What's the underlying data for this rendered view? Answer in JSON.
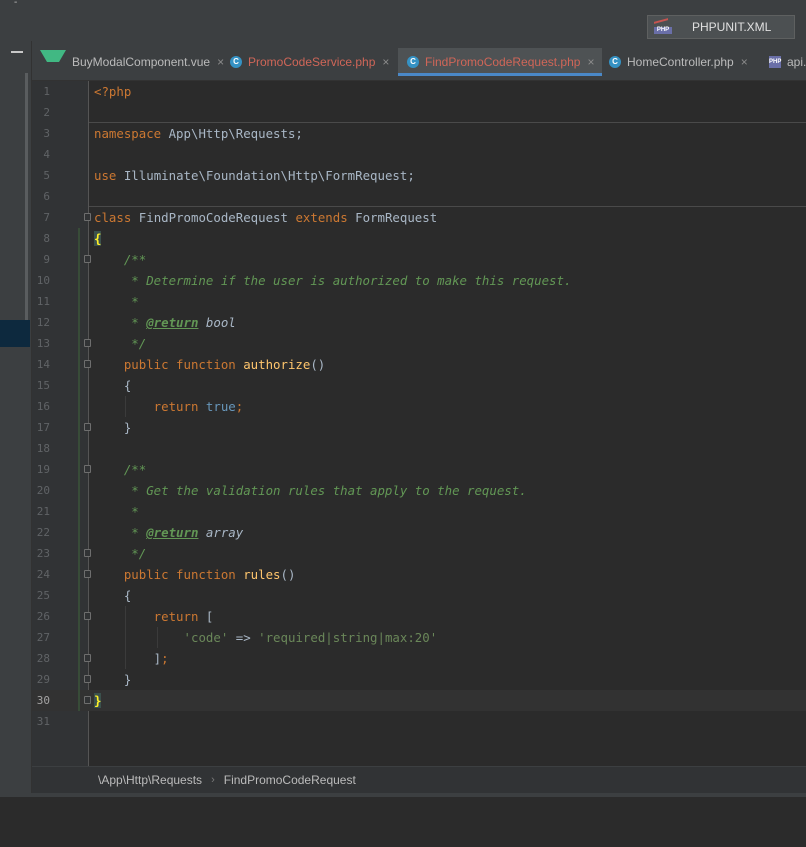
{
  "run_config": {
    "label": "PHPUNIT.XML",
    "icon": "php-icon"
  },
  "tabs": [
    {
      "label": "BuyModalComponent.vue",
      "icon": "vue-icon",
      "active": false,
      "close": "×"
    },
    {
      "label": "PromoCodeService.php",
      "icon": "class-icon",
      "active": false,
      "close": "×"
    },
    {
      "label": "FindPromoCodeRequest.php",
      "icon": "class-icon",
      "active": true,
      "close": "×"
    },
    {
      "label": "HomeController.php",
      "icon": "class-icon",
      "active": false,
      "close": "×"
    },
    {
      "label": "api.",
      "icon": "php-file-icon",
      "active": false,
      "close": ""
    }
  ],
  "editor": {
    "current_line": 30,
    "line_numbers": [
      "1",
      "2",
      "3",
      "4",
      "5",
      "6",
      "7",
      "8",
      "9",
      "10",
      "11",
      "12",
      "13",
      "14",
      "15",
      "16",
      "17",
      "18",
      "19",
      "20",
      "21",
      "22",
      "23",
      "24",
      "25",
      "26",
      "27",
      "28",
      "29",
      "30",
      "31"
    ],
    "code": {
      "l1": "<?php",
      "l3_kw": "namespace",
      "l3_ns": " App\\Http\\Requests;",
      "l5_kw": "use",
      "l5_ns": " Illuminate\\Foundation\\Http\\FormRequest;",
      "l7_kw1": "class",
      "l7_name": " FindPromoCodeRequest ",
      "l7_kw2": "extends",
      "l7_parent": " FormRequest",
      "l8": "{",
      "l9": "    /**",
      "l10": "     * Determine if the user is authorized to make this request.",
      "l11": "     *",
      "l12_pre": "     * ",
      "l12_tag": "@return",
      "l12_type": " bool",
      "l13": "     */",
      "l14_kw": "    public function ",
      "l14_fn": "authorize",
      "l14_rest": "()",
      "l15": "    {",
      "l16_kw": "        return ",
      "l16_val": "true",
      "l16_end": ";",
      "l17": "    }",
      "l19": "    /**",
      "l20": "     * Get the validation rules that apply to the request.",
      "l21": "     *",
      "l22_pre": "     * ",
      "l22_tag": "@return",
      "l22_type": " array",
      "l23": "     */",
      "l24_kw": "    public function ",
      "l24_fn": "rules",
      "l24_rest": "()",
      "l25": "    {",
      "l26_kw": "        return ",
      "l26_rest": "[",
      "l27_pre": "            ",
      "l27_key": "'code'",
      "l27_arrow": " => ",
      "l27_val": "'required|string|max:20'",
      "l28_pre": "        ]",
      "l28_end": ";",
      "l29": "    }",
      "l30": "}"
    }
  },
  "breadcrumb": {
    "namespace": "\\App\\Http\\Requests",
    "arrow": "›",
    "class": "FindPromoCodeRequest"
  },
  "colors": {
    "background": "#2b2b2b",
    "keyword": "#cc7832",
    "function": "#ffc66d",
    "comment": "#629755",
    "string": "#6a8759",
    "constant": "#6897bb",
    "active_tab_underline": "#4a88c7"
  }
}
